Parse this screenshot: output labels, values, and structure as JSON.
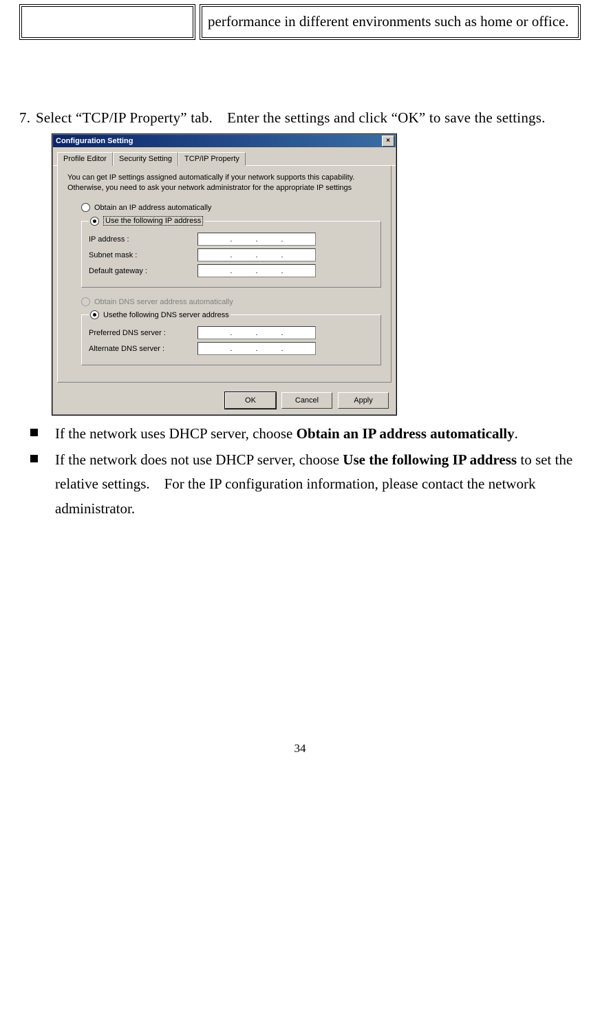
{
  "topTable": {
    "right": "performance in different environments such as home or office."
  },
  "step": {
    "num": "7.",
    "text": "Select “TCP/IP Property” tab. Enter the settings and click “OK” to save the settings."
  },
  "dialog": {
    "title": "Configuration Setting",
    "closeGlyph": "×",
    "tabs": [
      "Profile Editor",
      "Security Setting",
      "TCP/IP Property"
    ],
    "activeTab": 2,
    "desc": "You can get IP settings assigned automatically if your network supports this capability. Otherwise, you need to ask your network administrator for the appropriate IP settings",
    "ipMode": {
      "auto": "Obtain an IP address automatically",
      "manual": "Use the following IP address"
    },
    "ipFields": {
      "ip": "IP address :",
      "mask": "Subnet mask :",
      "gw": "Default gateway :"
    },
    "dnsMode": {
      "auto": "Obtain DNS server address automatically",
      "manual": "Usethe following DNS server address"
    },
    "dnsFields": {
      "pref": "Preferred DNS server :",
      "alt": "Alternate DNS server :"
    },
    "buttons": {
      "ok": "OK",
      "cancel": "Cancel",
      "apply": "Apply"
    }
  },
  "bullets": {
    "b1_pre": "If the network uses DHCP server, choose ",
    "b1_bold": "Obtain an IP address automatically",
    "b1_post": ".",
    "b2_pre": "If the network does not use DHCP server, choose ",
    "b2_bold": "Use the following IP address",
    "b2_post": " to set the relative settings. For the IP configuration information, please contact the network administrator."
  },
  "pageNumber": "34"
}
